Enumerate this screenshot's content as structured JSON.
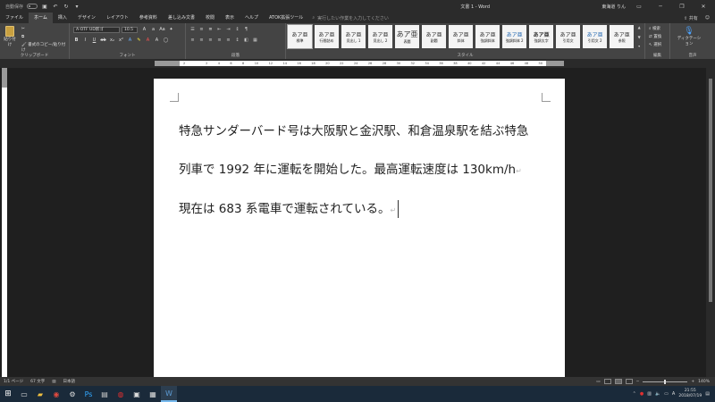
{
  "titlebar": {
    "autosave": "自動保存",
    "autosave_state": "オフ",
    "title": "文書 1 - Word",
    "user": "東海道 りん",
    "quick_access": [
      "save",
      "undo",
      "redo",
      "customize"
    ]
  },
  "tabs": [
    {
      "label": "ファイル",
      "active": false
    },
    {
      "label": "ホーム",
      "active": true
    },
    {
      "label": "挿入",
      "active": false
    },
    {
      "label": "デザイン",
      "active": false
    },
    {
      "label": "レイアウト",
      "active": false
    },
    {
      "label": "参考資料",
      "active": false
    },
    {
      "label": "差し込み文書",
      "active": false
    },
    {
      "label": "校閲",
      "active": false
    },
    {
      "label": "表示",
      "active": false
    },
    {
      "label": "ヘルプ",
      "active": false
    },
    {
      "label": "ATOK拡張ツール",
      "active": false
    }
  ],
  "tell_me": "実行したい作業を入力してください",
  "share": "共有",
  "ribbon": {
    "clipboard": {
      "paste": "貼り付け",
      "cut": "切り取り",
      "copy": "コピー",
      "format_painter": "書式のコピー/貼り付け",
      "label": "クリップボード"
    },
    "font": {
      "name": "A-OTF UD新ゴ",
      "size": "10.5",
      "label": "フォント"
    },
    "paragraph": {
      "label": "段落"
    },
    "styles": {
      "label": "スタイル",
      "items": [
        {
          "sample": "あア亜",
          "name": "標準",
          "selected": true
        },
        {
          "sample": "あア亜",
          "name": "行間詰め",
          "selected": false
        },
        {
          "sample": "あア亜",
          "name": "見出し 1",
          "selected": false
        },
        {
          "sample": "あア亜",
          "name": "見出し 2",
          "selected": false
        },
        {
          "sample": "あア亜",
          "name": "表題",
          "selected": false
        },
        {
          "sample": "あア亜",
          "name": "副題",
          "selected": false
        },
        {
          "sample": "あア亜",
          "name": "斜体",
          "selected": false
        },
        {
          "sample": "あア亜",
          "name": "強調斜体",
          "selected": false
        },
        {
          "sample": "あア亜",
          "name": "強調斜体 2",
          "selected": false
        },
        {
          "sample": "あア亜",
          "name": "強調太字",
          "selected": false
        },
        {
          "sample": "あア亜",
          "name": "引用文",
          "selected": false
        },
        {
          "sample": "あア亜",
          "name": "引用文 2",
          "selected": false
        },
        {
          "sample": "あア亜",
          "name": "参照",
          "selected": false
        }
      ]
    },
    "editing": {
      "find": "検索",
      "replace": "置換",
      "select": "選択",
      "label": "編集"
    },
    "voice": {
      "dictation": "ディクテーション",
      "label": "音声"
    }
  },
  "ruler": {
    "numbers": [
      "2",
      "",
      "2",
      "4",
      "6",
      "8",
      "10",
      "12",
      "14",
      "16",
      "18",
      "20",
      "22",
      "24",
      "26",
      "28",
      "30",
      "32",
      "34",
      "36",
      "38",
      "40",
      "42",
      "44",
      "46",
      "48",
      "50"
    ]
  },
  "document": {
    "lines": [
      "特急サンダーバード号は大阪駅と金沢駅、和倉温泉駅を結ぶ特急",
      "列車で 1992 年に運転を開始した。最高運転速度は 130km/h",
      "現在は 683 系電車で運転されている。"
    ],
    "para_mark": "↵"
  },
  "statusbar": {
    "page": "1/1 ページ",
    "words": "67 文字",
    "language": "日本語",
    "zoom": "140%"
  },
  "taskbar": {
    "time": "21:55",
    "date": "2018/07/19",
    "ime": "A"
  }
}
